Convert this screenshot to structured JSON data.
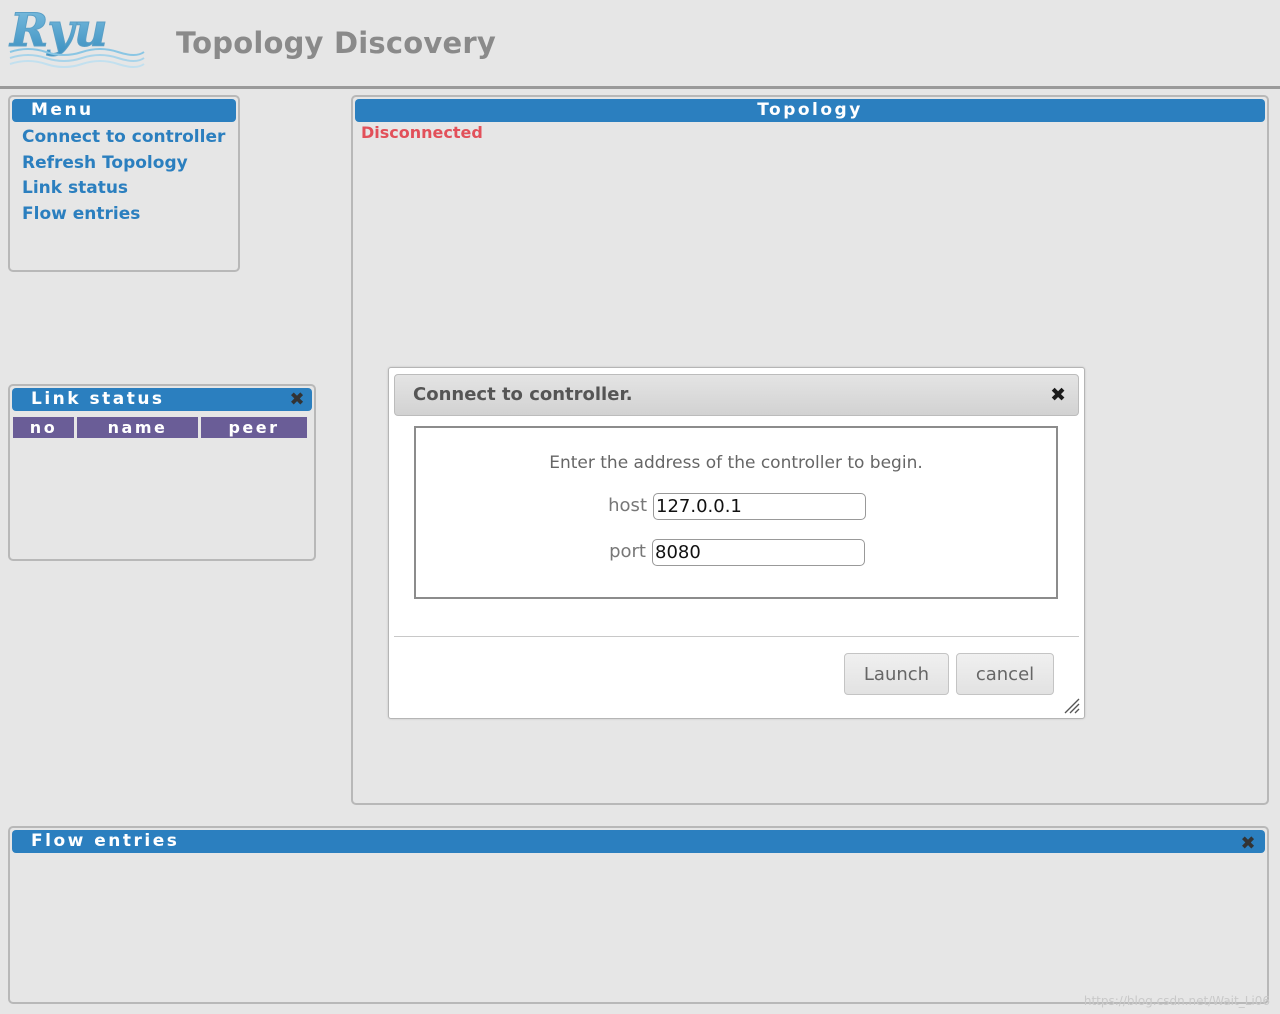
{
  "header": {
    "logo_text": "Ryu",
    "title": "Topology Discovery"
  },
  "menu": {
    "title": "Menu",
    "items": [
      {
        "label": "Connect to controller"
      },
      {
        "label": "Refresh Topology"
      },
      {
        "label": "Link status"
      },
      {
        "label": "Flow entries"
      }
    ]
  },
  "link_status": {
    "title": "Link status",
    "columns": [
      "no",
      "name",
      "peer"
    ]
  },
  "topology": {
    "title": "Topology",
    "status": "Disconnected"
  },
  "flow_entries": {
    "title": "Flow entries"
  },
  "dialog": {
    "title": "Connect to controller.",
    "message": "Enter the address of the controller to begin.",
    "host_label": "host",
    "host_value": "127.0.0.1",
    "port_label": "port",
    "port_value": "8080",
    "launch_label": "Launch",
    "cancel_label": "cancel"
  },
  "watermark": "https://blog.csdn.net/Wait_Li06",
  "colors": {
    "panel_bar": "#2b7fbf",
    "menu_link": "#2b7fbf",
    "table_header": "#6a5d97",
    "status_disconnected": "#e2505a"
  }
}
